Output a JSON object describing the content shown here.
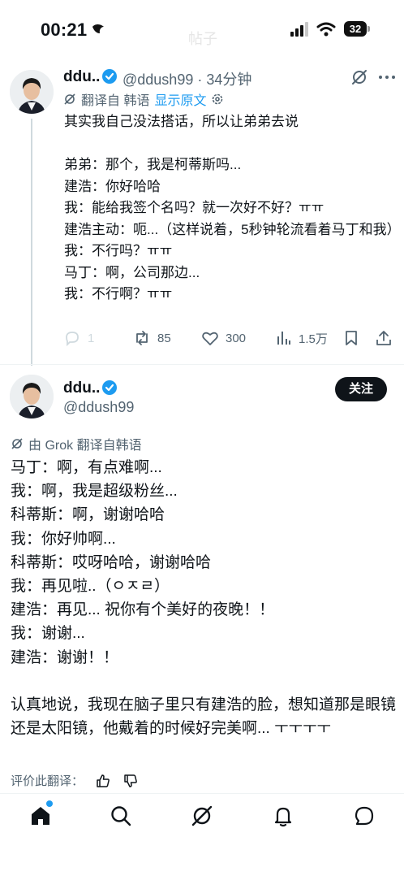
{
  "status_bar": {
    "time": "00:21",
    "background_title": "帖子",
    "battery": "32"
  },
  "tweet1": {
    "display_name": "ddu..",
    "handle_meta": "@ddush99 · 34分钟",
    "translated_from": "翻译自 韩语",
    "show_original": "显示原文",
    "lines": [
      "其实我自己没法搭话，所以让弟弟去说",
      "",
      "弟弟：那个，我是柯蒂斯吗...",
      "建浩：你好哈哈",
      "我：能给我签个名吗？就一次好不好？ㅠㅠ",
      "建浩主动：呃...（这样说着，5秒钟轮流看着马丁和我）",
      "我：不行吗？ㅠㅠ",
      "马丁：啊，公司那边...",
      "我：不行啊？ㅠㅠ"
    ],
    "actions": {
      "reply_count": "1",
      "retweet_count": "85",
      "like_count": "300",
      "view_count": "1.5万"
    }
  },
  "tweet2": {
    "display_name": "ddu..",
    "handle": "@ddush99",
    "follow_label": "关注",
    "grok_note": "由 Grok 翻译自韩语",
    "lines": [
      "马丁：啊，有点难啊...",
      "我：啊，我是超级粉丝...",
      "科蒂斯：啊，谢谢哈哈",
      "我：你好帅啊...",
      "科蒂斯：哎呀哈哈，谢谢哈哈",
      "我：再见啦..（ㅇㅈㄹ）",
      "建浩：再见... 祝你有个美好的夜晚！！",
      "我：谢谢...",
      "建浩：谢谢！！",
      "",
      "认真地说，我现在脑子里只有建浩的脸，想知道那是眼镜还是太阳镜，他戴着的时候好完美啊... ㅜㅜㅜㅜ"
    ],
    "rate_label": "评价此翻译："
  },
  "colors": {
    "accent": "#1d9bf0",
    "text": "#0f1419",
    "secondary": "#536471"
  }
}
